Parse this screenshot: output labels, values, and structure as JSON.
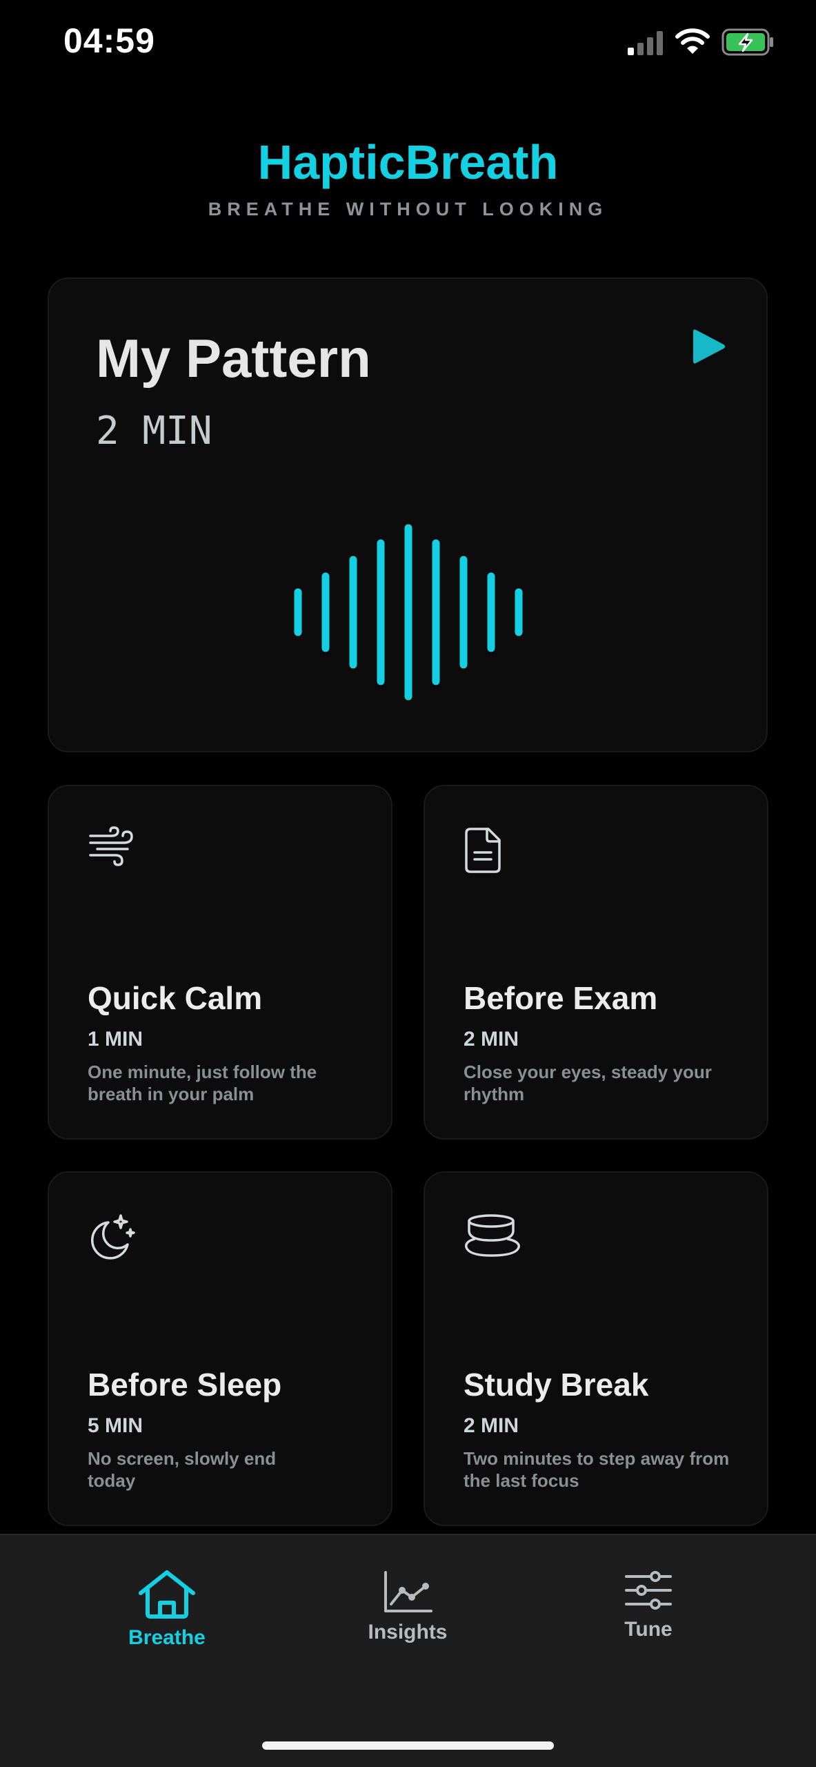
{
  "status_bar": {
    "time": "04:59",
    "icons": [
      "cellular-signal-icon",
      "wifi-icon",
      "battery-charging-icon"
    ]
  },
  "header": {
    "title": "HapticBreath",
    "subtitle": "BREATHE WITHOUT LOOKING"
  },
  "featured": {
    "title": "My Pattern",
    "duration": "2 MIN",
    "play_icon": "play-icon",
    "graphic_icon": "waveform-icon"
  },
  "presets": [
    {
      "title": "Quick Calm",
      "duration": "1 MIN",
      "description": "One minute, just follow the breath in your palm",
      "icon": "wind-icon"
    },
    {
      "title": "Before Exam",
      "duration": "2 MIN",
      "description": "Close your eyes, steady your rhythm",
      "icon": "document-icon"
    },
    {
      "title": "Before Sleep",
      "duration": "5 MIN",
      "description": "No screen, slowly end today",
      "icon": "moon-stars-icon"
    },
    {
      "title": "Study Break",
      "duration": "2 MIN",
      "description": "Two minutes to step away from the last focus",
      "icon": "cup-icon"
    }
  ],
  "tab_bar": {
    "tabs": [
      {
        "label": "Breathe",
        "icon": "home-icon",
        "active": true
      },
      {
        "label": "Insights",
        "icon": "chart-icon",
        "active": false
      },
      {
        "label": "Tune",
        "icon": "sliders-icon",
        "active": false
      }
    ]
  },
  "colors": {
    "accent": "#14d0e3",
    "background": "#000000",
    "card": "#0c0c0c",
    "tab_bar": "#1d1d1e"
  }
}
